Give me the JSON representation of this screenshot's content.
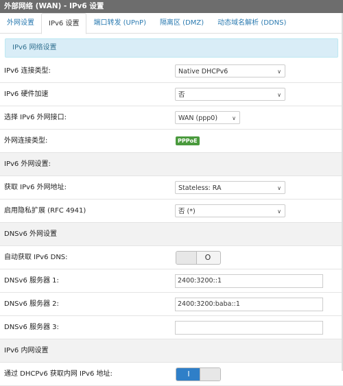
{
  "title": "外部网络 (WAN) - IPv6 设置",
  "tabs": [
    {
      "label": "外网设置"
    },
    {
      "label": "IPv6 设置"
    },
    {
      "label": "端口转发 (UPnP)"
    },
    {
      "label": "隔离区 (DMZ)"
    },
    {
      "label": "动态域名解析 (DDNS)"
    }
  ],
  "banner": "IPv6 网络设置",
  "rows": {
    "conn_type": {
      "label": "IPv6 连接类型:",
      "value": "Native DHCPv6"
    },
    "hw_accel": {
      "label": "IPv6 硬件加速",
      "value": "否"
    },
    "wan_iface": {
      "label": "选择 IPv6 外网接口:",
      "value": "WAN (ppp0)"
    },
    "wan_conn_type": {
      "label": "外网连接类型:",
      "badge": "PPPoE"
    },
    "wan_section": {
      "label": "IPv6 外网设置:"
    },
    "get_addr": {
      "label": "获取 IPv6 外网地址:",
      "value": "Stateless: RA"
    },
    "privacy": {
      "label": "启用隐私扩展 (RFC 4941)",
      "value": "否 (*)"
    },
    "dns_section": {
      "label": "DNSv6 外网设置"
    },
    "auto_dns": {
      "label": "自动获取 IPv6 DNS:",
      "toggle_symbol": "O"
    },
    "dns1": {
      "label": "DNSv6 服务器 1:",
      "value": "2400:3200::1"
    },
    "dns2": {
      "label": "DNSv6 服务器 2:",
      "value": "2400:3200:baba::1"
    },
    "dns3": {
      "label": "DNSv6 服务器 3:",
      "value": ""
    },
    "lan_section": {
      "label": "IPv6 内网设置"
    },
    "dhcp_lan": {
      "label": "通过 DHCPv6 获取内网 IPv6 地址:",
      "toggle_symbol": "I"
    }
  }
}
